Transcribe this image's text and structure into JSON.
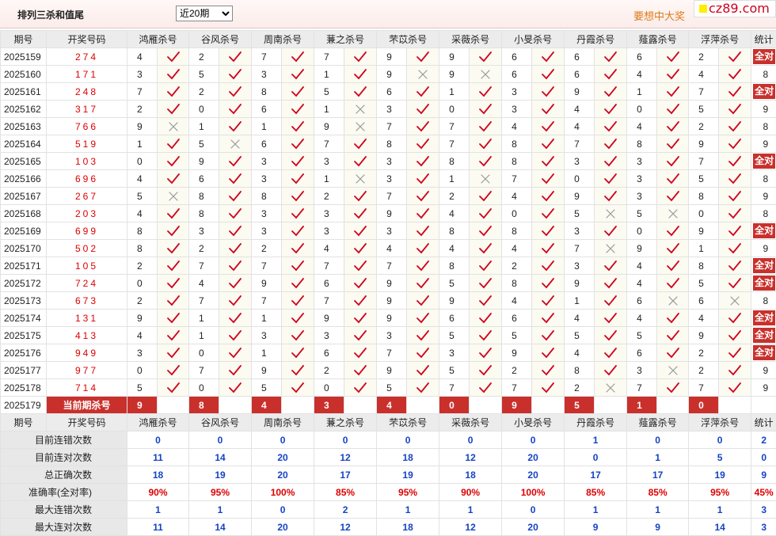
{
  "header": {
    "title": "排列三杀和值尾",
    "period_select": {
      "selected": "近20期",
      "options": [
        "近20期"
      ]
    },
    "promo": "要想中大奖",
    "logo_text": "cz89.com"
  },
  "columns": {
    "period": "期号",
    "draw": "开奖号码",
    "experts": [
      "鸿雁杀号",
      "谷风杀号",
      "周南杀号",
      "蒹之杀号",
      "芣苡杀号",
      "采薇杀号",
      "小旻杀号",
      "丹霞杀号",
      "薤露杀号",
      "浮萍杀号"
    ],
    "total": "统计"
  },
  "rows": [
    {
      "period": "2025159",
      "draw": "274",
      "kills": [
        4,
        2,
        7,
        7,
        9,
        9,
        6,
        6,
        6,
        2
      ],
      "hits": [
        1,
        1,
        1,
        1,
        1,
        1,
        1,
        1,
        1,
        1
      ],
      "total": "全对"
    },
    {
      "period": "2025160",
      "draw": "171",
      "kills": [
        3,
        5,
        3,
        1,
        9,
        9,
        6,
        6,
        4,
        4
      ],
      "hits": [
        1,
        1,
        1,
        1,
        0,
        0,
        1,
        1,
        1,
        1
      ],
      "total": "8"
    },
    {
      "period": "2025161",
      "draw": "248",
      "kills": [
        7,
        2,
        8,
        5,
        6,
        1,
        3,
        9,
        1,
        7
      ],
      "hits": [
        1,
        1,
        1,
        1,
        1,
        1,
        1,
        1,
        1,
        1
      ],
      "total": "全对"
    },
    {
      "period": "2025162",
      "draw": "317",
      "kills": [
        2,
        0,
        6,
        1,
        3,
        0,
        3,
        4,
        0,
        5
      ],
      "hits": [
        1,
        1,
        1,
        0,
        1,
        1,
        1,
        1,
        1,
        1
      ],
      "total": "9"
    },
    {
      "period": "2025163",
      "draw": "766",
      "kills": [
        9,
        1,
        1,
        9,
        7,
        7,
        4,
        4,
        4,
        2
      ],
      "hits": [
        0,
        1,
        1,
        0,
        1,
        1,
        1,
        1,
        1,
        1
      ],
      "total": "8"
    },
    {
      "period": "2025164",
      "draw": "519",
      "kills": [
        1,
        5,
        6,
        7,
        8,
        7,
        8,
        7,
        8,
        9
      ],
      "hits": [
        1,
        0,
        1,
        1,
        1,
        1,
        1,
        1,
        1,
        1
      ],
      "total": "9"
    },
    {
      "period": "2025165",
      "draw": "103",
      "kills": [
        0,
        9,
        3,
        3,
        3,
        8,
        8,
        3,
        3,
        7
      ],
      "hits": [
        1,
        1,
        1,
        1,
        1,
        1,
        1,
        1,
        1,
        1
      ],
      "total": "全对"
    },
    {
      "period": "2025166",
      "draw": "696",
      "kills": [
        4,
        6,
        3,
        1,
        3,
        1,
        7,
        0,
        3,
        5
      ],
      "hits": [
        1,
        1,
        1,
        0,
        1,
        0,
        1,
        1,
        1,
        1
      ],
      "total": "8"
    },
    {
      "period": "2025167",
      "draw": "267",
      "kills": [
        5,
        8,
        8,
        2,
        7,
        2,
        4,
        9,
        3,
        8
      ],
      "hits": [
        0,
        1,
        1,
        1,
        1,
        1,
        1,
        1,
        1,
        1
      ],
      "total": "9"
    },
    {
      "period": "2025168",
      "draw": "203",
      "kills": [
        4,
        8,
        3,
        3,
        9,
        4,
        0,
        5,
        5,
        0
      ],
      "hits": [
        1,
        1,
        1,
        1,
        1,
        1,
        1,
        0,
        0,
        1
      ],
      "total": "8"
    },
    {
      "period": "2025169",
      "draw": "699",
      "kills": [
        8,
        3,
        3,
        3,
        3,
        8,
        8,
        3,
        0,
        9
      ],
      "hits": [
        1,
        1,
        1,
        1,
        1,
        1,
        1,
        1,
        1,
        1
      ],
      "total": "全对"
    },
    {
      "period": "2025170",
      "draw": "502",
      "kills": [
        8,
        2,
        2,
        4,
        4,
        4,
        4,
        7,
        9,
        1
      ],
      "hits": [
        1,
        1,
        1,
        1,
        1,
        1,
        1,
        0,
        1,
        1
      ],
      "total": "9"
    },
    {
      "period": "2025171",
      "draw": "105",
      "kills": [
        2,
        7,
        7,
        7,
        7,
        8,
        2,
        3,
        4,
        8
      ],
      "hits": [
        1,
        1,
        1,
        1,
        1,
        1,
        1,
        1,
        1,
        1
      ],
      "total": "全对"
    },
    {
      "period": "2025172",
      "draw": "724",
      "kills": [
        0,
        4,
        9,
        6,
        9,
        5,
        8,
        9,
        4,
        5
      ],
      "hits": [
        1,
        1,
        1,
        1,
        1,
        1,
        1,
        1,
        1,
        1
      ],
      "total": "全对"
    },
    {
      "period": "2025173",
      "draw": "673",
      "kills": [
        2,
        7,
        7,
        7,
        9,
        9,
        4,
        1,
        6,
        6
      ],
      "hits": [
        1,
        1,
        1,
        1,
        1,
        1,
        1,
        1,
        0,
        0
      ],
      "total": "8"
    },
    {
      "period": "2025174",
      "draw": "131",
      "kills": [
        9,
        1,
        1,
        9,
        9,
        6,
        6,
        4,
        4,
        4
      ],
      "hits": [
        1,
        1,
        1,
        1,
        1,
        1,
        1,
        1,
        1,
        1
      ],
      "total": "全对"
    },
    {
      "period": "2025175",
      "draw": "413",
      "kills": [
        4,
        1,
        3,
        3,
        3,
        5,
        5,
        5,
        5,
        9
      ],
      "hits": [
        1,
        1,
        1,
        1,
        1,
        1,
        1,
        1,
        1,
        1
      ],
      "total": "全对"
    },
    {
      "period": "2025176",
      "draw": "949",
      "kills": [
        3,
        0,
        1,
        6,
        7,
        3,
        9,
        4,
        6,
        2
      ],
      "hits": [
        1,
        1,
        1,
        1,
        1,
        1,
        1,
        1,
        1,
        1
      ],
      "total": "全对"
    },
    {
      "period": "2025177",
      "draw": "977",
      "kills": [
        0,
        7,
        9,
        2,
        9,
        5,
        2,
        8,
        3,
        2
      ],
      "hits": [
        1,
        1,
        1,
        1,
        1,
        1,
        1,
        1,
        0,
        1
      ],
      "total": "9"
    },
    {
      "period": "2025178",
      "draw": "714",
      "kills": [
        5,
        0,
        5,
        0,
        5,
        7,
        7,
        2,
        7,
        7
      ],
      "hits": [
        1,
        1,
        1,
        1,
        1,
        1,
        1,
        0,
        1,
        1
      ],
      "total": "9"
    }
  ],
  "current": {
    "period": "2025179",
    "label": "当前期杀号",
    "kills": [
      9,
      8,
      4,
      3,
      4,
      0,
      9,
      5,
      1,
      0
    ]
  },
  "summary": [
    {
      "label": "目前连错次数",
      "values": [
        "0",
        "0",
        "0",
        "0",
        "0",
        "0",
        "0",
        "1",
        "0",
        "0"
      ],
      "total": "2"
    },
    {
      "label": "目前连对次数",
      "values": [
        "11",
        "14",
        "20",
        "12",
        "18",
        "12",
        "20",
        "0",
        "1",
        "5"
      ],
      "total": "0"
    },
    {
      "label": "总正确次数",
      "values": [
        "18",
        "19",
        "20",
        "17",
        "19",
        "18",
        "20",
        "17",
        "17",
        "19"
      ],
      "total": "9"
    },
    {
      "label": "准确率(全对率)",
      "values": [
        "90%",
        "95%",
        "100%",
        "85%",
        "95%",
        "90%",
        "100%",
        "85%",
        "85%",
        "95%"
      ],
      "total": "45%",
      "rate": true
    },
    {
      "label": "最大连错次数",
      "values": [
        "1",
        "1",
        "0",
        "2",
        "1",
        "1",
        "0",
        "1",
        "1",
        "1"
      ],
      "total": "3"
    },
    {
      "label": "最大连对次数",
      "values": [
        "11",
        "14",
        "20",
        "12",
        "18",
        "12",
        "20",
        "9",
        "9",
        "14"
      ],
      "total": "3"
    }
  ],
  "colors": {
    "accent_red": "#c9302c",
    "hit": "#d0021b",
    "miss": "#999999",
    "stat_blue": "#1543c4",
    "promo": "#e07a1a"
  },
  "icons": {
    "hit": "check-icon",
    "miss": "cross-icon"
  }
}
